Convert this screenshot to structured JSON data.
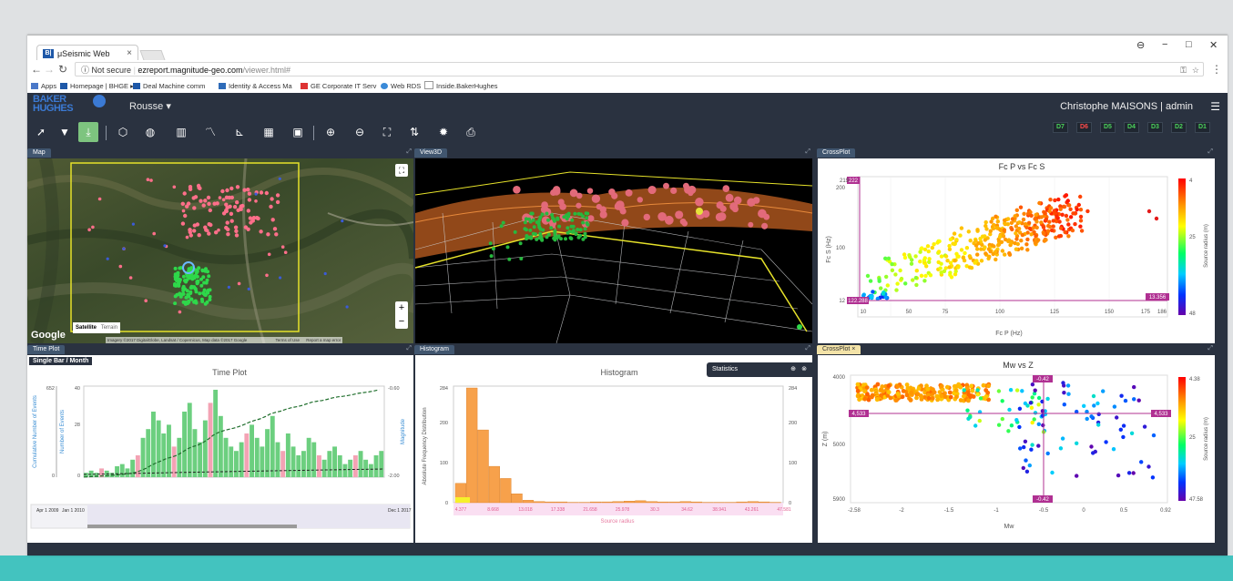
{
  "browser": {
    "tab_title": "μSeismic Web Platform",
    "tab_close": "×",
    "tab_icon": "B|",
    "url_security": "Not secure",
    "url_host": "ezreport.magnitude-geo.com",
    "url_path": "/viewer.html#",
    "bookmarks": [
      "Apps",
      "Homepage | BHGE ▸",
      "Deal Machine comm",
      "Identity & Access Ma",
      "GE Corporate IT Serv",
      "Web RDS",
      "Inside.BakerHughes"
    ]
  },
  "app": {
    "logo_line1": "BAKER",
    "logo_line2": "HUGHES",
    "project": "Rousse",
    "user": "Christophe MAISONS | admin",
    "data_chips": [
      {
        "label": "D7",
        "color": "#4bd25a"
      },
      {
        "label": "D6",
        "color": "#ff4b4b"
      },
      {
        "label": "D5",
        "color": "#4bd25a"
      },
      {
        "label": "D4",
        "color": "#4bd25a"
      },
      {
        "label": "D3",
        "color": "#4bd25a"
      },
      {
        "label": "D2",
        "color": "#4bd25a"
      },
      {
        "label": "D1",
        "color": "#4bd25a"
      }
    ]
  },
  "panels": {
    "map": {
      "tab": "Map",
      "google": "Google",
      "satellite": "Satellite",
      "terrain": "Terrain",
      "zoom_in": "+",
      "zoom_out": "−",
      "attribution": "Imagery ©2017 DigitalGlobe, Landsat / Copernicus, Map data ©2017 Google",
      "terms": "Terms of Use",
      "report": "Report a map error"
    },
    "view3d": {
      "tab": "View3D"
    },
    "crossplot1": {
      "tab": "CrossPlot",
      "title": "Fc P vs Fc S",
      "xlabel": "Fc P (Hz)",
      "ylabel": "Fc S (Hz)",
      "colorbar_label": "Source radius (m)",
      "colorbar_ticks": [
        "4",
        "25",
        "48"
      ],
      "x_ticks": [
        "10",
        "50",
        "75",
        "100",
        "125",
        "150",
        "175",
        "186"
      ],
      "y_ticks": [
        "12",
        "100",
        "200",
        "219"
      ],
      "markers": [
        "222",
        "122.288",
        "13.356"
      ]
    },
    "timeplot": {
      "tab": "Time Plot",
      "mode": "Single Bar / Month",
      "title": "Time Plot",
      "y1label": "Cumulative Number of Events",
      "y2label": "Number of Events",
      "y3label": "Magnitude",
      "y_ticks_left": [
        "652",
        "0"
      ],
      "y_ticks_mid": [
        "40",
        "28",
        "0"
      ],
      "y_ticks_right": [
        "-0.60",
        "-2.00"
      ],
      "timeline_start": "Apr 1 2009",
      "timeline_mid": "Jan 1 2010",
      "timeline_end": "Dec 1 2017"
    },
    "histogram": {
      "tab": "Histogram",
      "title": "Histogram",
      "ylabel": "Absolute Frequency Distribution",
      "xlabel": "Source radius",
      "y_ticks": [
        "284",
        "200",
        "100",
        "0"
      ],
      "x_ticks": [
        "4.377",
        "8.668",
        "13.018",
        "17.338",
        "21.658",
        "25.978",
        "30.3",
        "34.62",
        "38.941",
        "43.261",
        "47.581"
      ]
    },
    "statistics": {
      "label": "Statistics"
    },
    "crossplot2": {
      "tab": "CrossPlot",
      "tab_close": "×",
      "title": "Mw vs Z",
      "xlabel": "Mw",
      "ylabel": "Z (m)",
      "colorbar_label": "Source radius (m)",
      "colorbar_ticks": [
        "4.38",
        "25",
        "47.58"
      ],
      "x_ticks": [
        "-2.58",
        "-2",
        "-1.5",
        "-1",
        "-0.5",
        "0",
        "0.5",
        "0.92"
      ],
      "y_ticks": [
        "4000",
        "5000",
        "5900"
      ],
      "markers": [
        "-0.42",
        "4,533",
        "4,533",
        "-0.42"
      ]
    }
  }
}
